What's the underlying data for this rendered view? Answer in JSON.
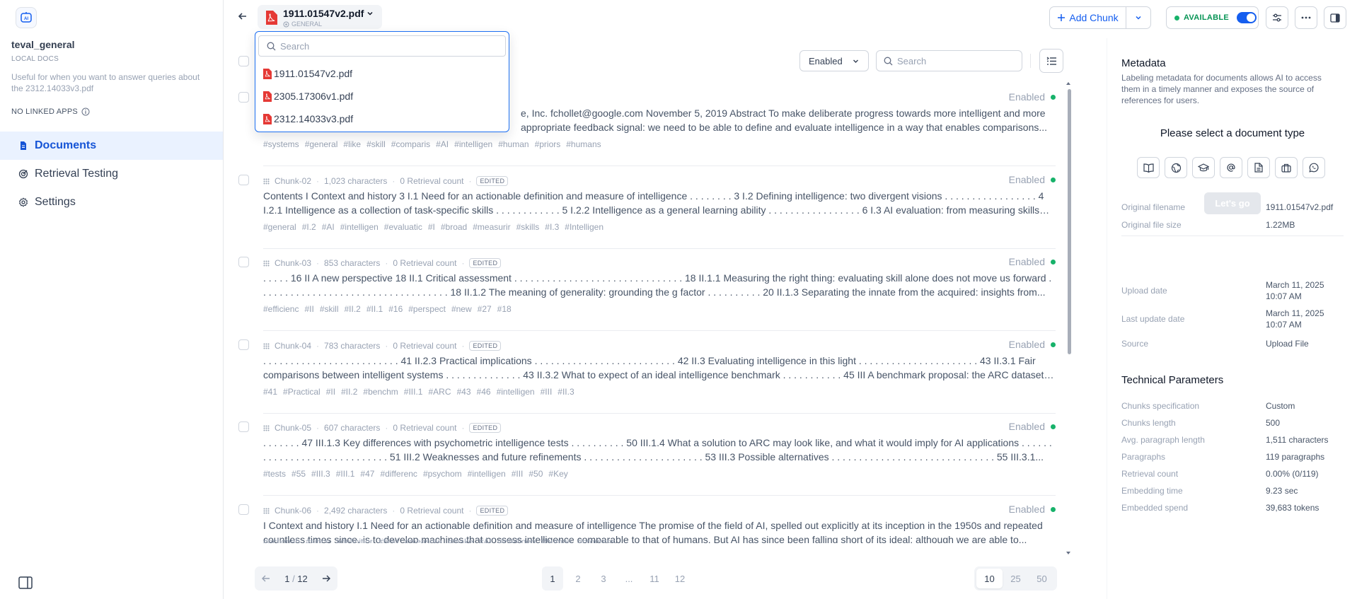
{
  "sidebar": {
    "dataset_name": "teval_general",
    "dataset_type": "LOCAL DOCS",
    "description": "Useful for when you want to answer queries about the 2312.14033v3.pdf",
    "linked_apps": "NO LINKED APPS",
    "nav": [
      {
        "label": "Documents",
        "icon": "document-icon",
        "active": true
      },
      {
        "label": "Retrieval Testing",
        "icon": "target-icon",
        "active": false
      },
      {
        "label": "Settings",
        "icon": "gear-icon",
        "active": false
      }
    ]
  },
  "header": {
    "doc_name": "1911.01547v2.pdf",
    "doc_subtitle": "GENERAL",
    "add_chunk_label": "Add Chunk",
    "status_label": "AVAILABLE"
  },
  "doc_dropdown": {
    "search_placeholder": "Search",
    "items": [
      "1911.01547v2.pdf",
      "2305.17306v1.pdf",
      "2312.14033v3.pdf"
    ]
  },
  "toolbar": {
    "filter_value": "Enabled",
    "search_placeholder": "Search"
  },
  "chunks": [
    {
      "id": "Chunk-01",
      "chars": "",
      "retrieval": "",
      "edited": "",
      "status": "Enabled",
      "content": "e, Inc. fchollet@google.com November 5, 2019 Abstract To make deliberate progress towards more intelligent and more appropriate feedback signal: we need to be able to define and evaluate intelligence in a way that enables comparisons...",
      "tags": [
        "#systems",
        "#general",
        "#like",
        "#skill",
        "#comparis",
        "#AI",
        "#intelligen",
        "#human",
        "#priors",
        "#humans"
      ]
    },
    {
      "id": "Chunk-02",
      "chars": "1,023 characters",
      "retrieval": "0 Retrieval count",
      "edited": "EDITED",
      "status": "Enabled",
      "content": "Contents I Context and history 3 I.1 Need for an actionable definition and measure of intelligence . . . . . . . . 3 I.2 Defining intelligence: two divergent visions . . . . . . . . . . . . . . . . . 4 I.2.1 Intelligence as a collection of task-specific skills . . . . . . . . . . . . 5 I.2.2 Intelligence as a general learning ability . . . . . . . . . . . . . . . . . 6 I.3 AI evaluation: from measuring skills to...",
      "tags": [
        "#general",
        "#I.2",
        "#AI",
        "#intelligen",
        "#evaluatic",
        "#I",
        "#broad",
        "#measurir",
        "#skills",
        "#I.3",
        "#Intelligen"
      ]
    },
    {
      "id": "Chunk-03",
      "chars": "853 characters",
      "retrieval": "0 Retrieval count",
      "edited": "EDITED",
      "status": "Enabled",
      "content": ". . . . . 16 II A new perspective 18 II.1 Critical assessment . . . . . . . . . . . . . . . . . . . . . . . . . . . . . . . 18 II.1.1 Measuring the right thing: evaluating skill alone does not move us forward . . . . . . . . . . . . . . . . . . . . . . . . . . . . . . . . . . . 18 II.1.2 The meaning of generality: grounding the g factor . . . . . . . . . . 20 II.1.3 Separating the innate from the acquired: insights from...",
      "tags": [
        "#efficienc",
        "#II",
        "#skill",
        "#II.2",
        "#II.1",
        "#16",
        "#perspect",
        "#new",
        "#27",
        "#18"
      ]
    },
    {
      "id": "Chunk-04",
      "chars": "783 characters",
      "retrieval": "0 Retrieval count",
      "edited": "EDITED",
      "status": "Enabled",
      "content": ". . . . . . . . . . . . . . . . . . . . . . . . . 41 II.2.3 Practical implications . . . . . . . . . . . . . . . . . . . . . . . . . . 42 II.3 Evaluating intelligence in this light . . . . . . . . . . . . . . . . . . . . . . 43 II.3.1 Fair comparisons between intelligent systems . . . . . . . . . . . . . . 43 II.3.2 What to expect of an ideal intelligence benchmark . . . . . . . . . . . 45 III A benchmark proposal: the ARC dataset 46...",
      "tags": [
        "#41",
        "#Practical",
        "#II",
        "#II.2",
        "#benchm",
        "#III.1",
        "#ARC",
        "#43",
        "#46",
        "#intelligen",
        "#III",
        "#II.3"
      ]
    },
    {
      "id": "Chunk-05",
      "chars": "607 characters",
      "retrieval": "0 Retrieval count",
      "edited": "EDITED",
      "status": "Enabled",
      "content": ". . . . . . . 47 III.1.3 Key differences with psychometric intelligence tests . . . . . . . . . . 50 III.1.4 What a solution to ARC may look like, and what it would imply for AI applications . . . . . . . . . . . . . . . . . . . . . . . . . . . . . 51 III.2 Weaknesses and future refinements . . . . . . . . . . . . . . . . . . . . . . 53 III.3 Possible alternatives . . . . . . . . . . . . . . . . . . . . . . . . . . . . . . 55 III.3.1...",
      "tags": [
        "#tests",
        "#55",
        "#III.3",
        "#III.1",
        "#47",
        "#differenc",
        "#psychom",
        "#intelligen",
        "#III",
        "#50",
        "#Key"
      ]
    },
    {
      "id": "Chunk-06",
      "chars": "2,492 characters",
      "retrieval": "0 Retrieval count",
      "edited": "EDITED",
      "status": "Enabled",
      "content": "I Context and history I.1 Need for an actionable definition and measure of intelligence The promise of the field of AI, spelled out explicitly at its inception in the 1950s and repeated countless times since, is to develop machines that possess intelligence comparable to that of humans. But AI has since been falling short of its ideal: although we are able to...",
      "tags": [
        "#actionab",
        "#since",
        "#definitior",
        "#field",
        "#measure",
        "#make",
        "#AI",
        "#intelligen",
        "#human",
        "#progress"
      ]
    }
  ],
  "pagination": {
    "current": "1",
    "total": "12",
    "pages": [
      "1",
      "2",
      "3",
      "...",
      "11",
      "12"
    ],
    "sizes": [
      "10",
      "25",
      "50"
    ]
  },
  "metadata": {
    "title": "Metadata",
    "description": "Labeling metadata for documents allows AI to access them in a timely manner and exposes the source of references for users.",
    "select_prompt": "Please select a document type",
    "lets_go": "Let's go",
    "type_icons": [
      "book-icon",
      "globe-icon",
      "graduation-cap-icon",
      "at-sign-icon",
      "file-icon",
      "briefcase-icon",
      "chat-icon"
    ],
    "fields": [
      {
        "k": "Original filename",
        "v": "1911.01547v2.pdf"
      },
      {
        "k": "Original file size",
        "v": "1.22MB"
      },
      {
        "k": "Upload date",
        "v": "March 11, 2025 10:07 AM"
      },
      {
        "k": "Last update date",
        "v": "March 11, 2025 10:07 AM"
      },
      {
        "k": "Source",
        "v": "Upload File"
      }
    ],
    "tech_title": "Technical Parameters",
    "tech": [
      {
        "k": "Chunks specification",
        "v": "Custom"
      },
      {
        "k": "Chunks length",
        "v": "500"
      },
      {
        "k": "Avg. paragraph length",
        "v": "1,511 characters"
      },
      {
        "k": "Paragraphs",
        "v": "119 paragraphs"
      },
      {
        "k": "Retrieval count",
        "v": "0.00% (0/119)"
      },
      {
        "k": "Embedding time",
        "v": "9.23 sec"
      },
      {
        "k": "Embedded spend",
        "v": "39,683 tokens"
      }
    ]
  }
}
